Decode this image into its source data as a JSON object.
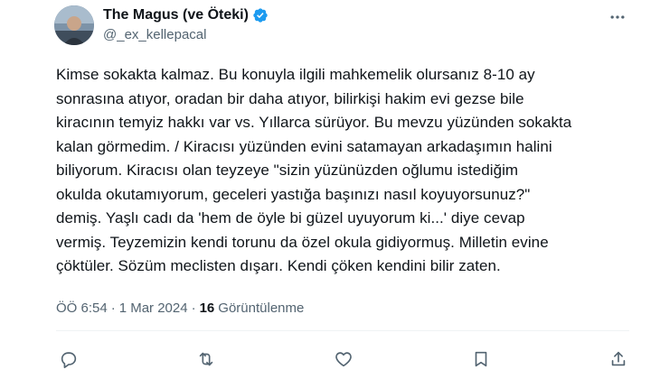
{
  "author": {
    "display_name": "The Magus (ve Öteki)",
    "handle": "@_ex_kellepacal",
    "verified": true
  },
  "tweet": {
    "text": "Kimse sokakta kalmaz. Bu konuyla ilgili mahkemelik olursanız  8-10 ay\nsonrasına atıyor, oradan bir daha atıyor, bilirkişi hakim evi gezse bile\nkiracının temyiz hakkı var vs. Yıllarca sürüyor. Bu mevzu yüzünden sokakta\nkalan görmedim. / Kiracısı yüzünden evini satamayan arkadaşımın halini\nbiliyorum. Kiracısı olan teyzeye \"sizin yüzünüzden oğlumu istediğim\nokulda okutamıyorum, geceleri yastığa başınızı nasıl koyuyorsunuz?\"\ndemiş. Yaşlı cadı da 'hem de öyle bi güzel uyuyorum ki...' diye cevap\nvermiş. Teyzemizin kendi torunu da özel okula gidiyormuş. Milletin evine\nçöktüler. Sözüm meclisten dışarı. Kendi çöken kendini bilir zaten.",
    "time": "ÖÖ 6:54",
    "separator": "·",
    "date": "1 Mar 2024",
    "views_count": "16",
    "views_label": "Görüntülenme"
  },
  "icons": {
    "verified": "verified-badge-icon",
    "more": "more-icon",
    "reply": "reply-icon",
    "retweet": "retweet-icon",
    "like": "like-icon",
    "bookmark": "bookmark-icon",
    "share": "share-icon"
  },
  "colors": {
    "verified": "#1d9bf0",
    "text_primary": "#0f1419",
    "text_secondary": "#536471",
    "divider": "#eff3f4"
  }
}
